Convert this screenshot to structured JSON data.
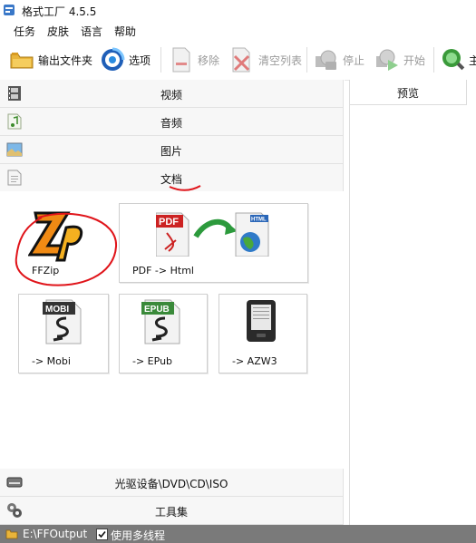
{
  "window": {
    "title": "格式工厂 4.5.5"
  },
  "menu": {
    "items": [
      "任务",
      "皮肤",
      "语言",
      "帮助"
    ]
  },
  "toolbar": {
    "output_folder": "输出文件夹",
    "options": "选项",
    "remove": "移除",
    "clear_list": "清空列表",
    "stop": "停止",
    "start": "开始",
    "partial": "主"
  },
  "categories": {
    "video": "视频",
    "audio": "音频",
    "image": "图片",
    "document": "文档",
    "optical": "光驱设备\\DVD\\CD\\ISO",
    "tools": "工具集"
  },
  "tiles": {
    "ffzip": "FFZip",
    "pdf_html": "PDF -> Html",
    "mobi": "-> Mobi",
    "epub": "-> EPub",
    "azw3": "-> AZW3"
  },
  "icon_text": {
    "pdf": "PDF",
    "html": "HTML",
    "mobi": "MOBI",
    "epub": "EPUB"
  },
  "preview": {
    "header": "预览"
  },
  "status": {
    "output_path": "E:\\FFOutput",
    "multithread_label": "使用多线程",
    "multithread_checked": true
  },
  "colors": {
    "annotation_red": "#e0141a",
    "pdf_red": "#cc2222",
    "epub_green": "#3a8a3a",
    "arrow_green": "#2c9a3c",
    "statusbar": "#7a7a7a"
  }
}
